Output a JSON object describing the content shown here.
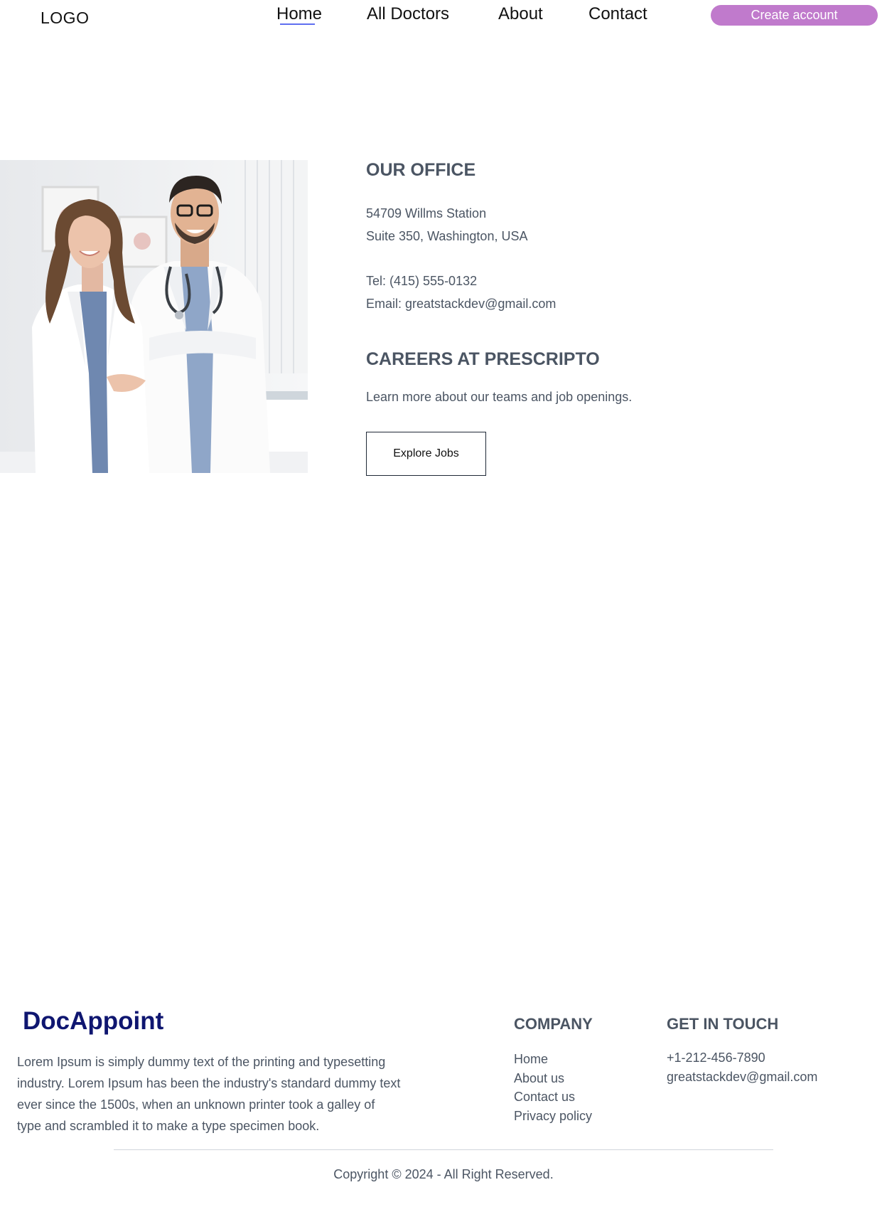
{
  "header": {
    "logo": "LOGO",
    "nav": [
      {
        "label": "Home",
        "active": true
      },
      {
        "label": "All Doctors"
      },
      {
        "label": "About"
      },
      {
        "label": "Contact"
      }
    ],
    "create_account_label": "Create account",
    "accent_color": "#c07acc",
    "active_underline_color": "#5f6ff0"
  },
  "office": {
    "title": "OUR OFFICE",
    "address_line1": "54709 Willms Station",
    "address_line2": "Suite 350, Washington, USA",
    "tel": "Tel: (415) 555-0132",
    "email": "Email: greatstackdev@gmail.com"
  },
  "careers": {
    "title": "CAREERS AT PRESCRIPTO",
    "text": "Learn more about our teams and job openings.",
    "button_label": "Explore Jobs"
  },
  "footer": {
    "brand": "DocAppoint",
    "brand_color": "#0f1670",
    "description": "Lorem Ipsum is simply dummy text of the printing and typesetting industry. Lorem Ipsum has been the industry's standard dummy text ever since the 1500s, when an unknown printer took a galley of type and scrambled it to make a type specimen book.",
    "company_title": "COMPANY",
    "company_links": [
      "Home",
      "About us",
      "Contact us",
      "Privacy policy"
    ],
    "touch_title": "GET IN TOUCH",
    "phone": "+1-212-456-7890",
    "email": "greatstackdev@gmail.com",
    "copyright": "Copyright © 2024 - All Right Reserved."
  }
}
